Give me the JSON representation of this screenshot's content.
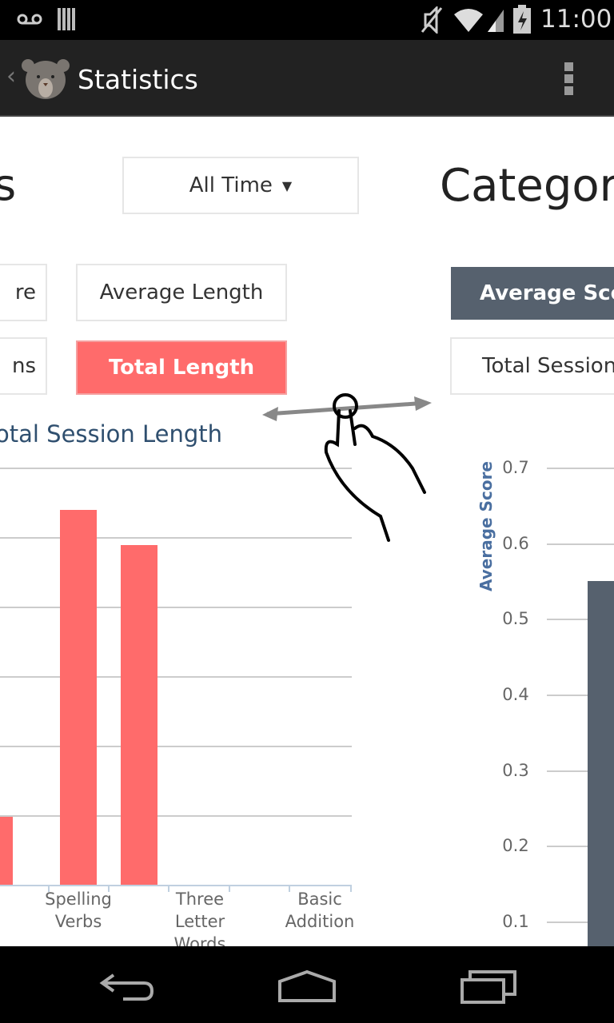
{
  "status_bar": {
    "time": "11:00",
    "icons": [
      "voicemail-icon",
      "signal-bars-icon",
      "mute-icon",
      "wifi-icon",
      "cell-signal-icon",
      "battery-charging-icon"
    ]
  },
  "app_bar": {
    "title": "Statistics",
    "back_icon": "chevron-left-icon",
    "logo": "bear-logo",
    "menu_icon": "overflow-menu-icon"
  },
  "left_page": {
    "title_fragment": "s",
    "time_filter": "All Time",
    "buttons": [
      {
        "label": "re",
        "selected": false
      },
      {
        "label": "Average Length",
        "selected": false
      },
      {
        "label": "ns",
        "selected": false
      },
      {
        "label": "Total Length",
        "selected": true
      }
    ],
    "chart_title": "otal Session Length"
  },
  "right_page": {
    "title_fragment": "Categori",
    "buttons": [
      {
        "label": "Average Scor",
        "selected": true
      },
      {
        "label": "Total Session",
        "selected": false
      }
    ]
  },
  "colors": {
    "accent_red": "#ff6b6b",
    "selected_dark": "#56616e",
    "axis_title": "#4a6fa0"
  },
  "chart_data": [
    {
      "type": "bar",
      "title": "otal Session Length",
      "categories": [
        "",
        "Spelling Verbs",
        "",
        "Three Letter Words",
        "",
        "Basic Addition"
      ],
      "values": [
        0.98,
        5.39,
        4.89,
        0,
        0,
        0
      ],
      "note_units": "gridline intervals",
      "grid": true
    },
    {
      "type": "bar",
      "ylabel": "Average Score",
      "yticks": [
        "0.7",
        "0.6",
        "0.5",
        "0.4",
        "0.3",
        "0.2",
        "0.1"
      ],
      "values": [
        0.55
      ],
      "grid": true
    }
  ],
  "gesture": {
    "icon": "swipe-horizontal-hand-icon"
  },
  "nav_bar": {
    "icons": [
      "back-icon",
      "home-icon",
      "recents-icon"
    ]
  }
}
